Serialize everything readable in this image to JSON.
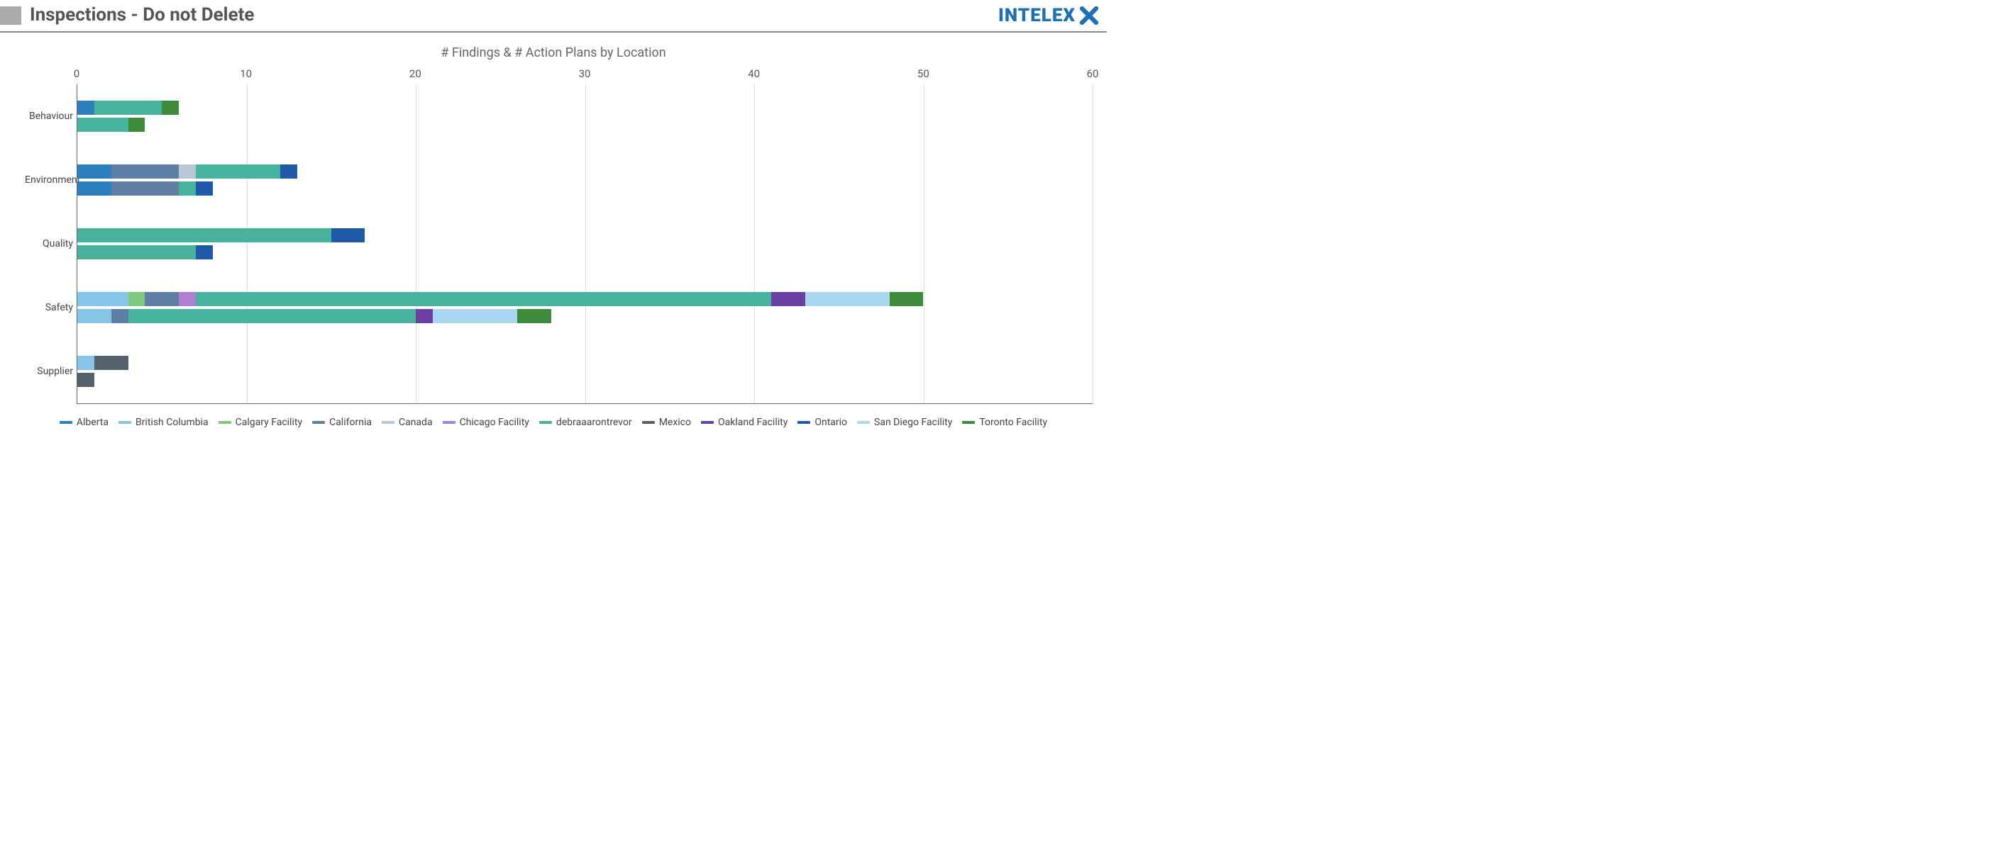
{
  "header": {
    "title": "Inspections - Do not Delete",
    "brand": "INTELEX"
  },
  "chart_data": {
    "type": "bar",
    "orientation": "horizontal-stacked-grouped",
    "title": "# Findings & # Action Plans by Location",
    "xlim": [
      0,
      60
    ],
    "xticks": [
      0,
      10,
      20,
      30,
      40,
      50,
      60
    ],
    "categories": [
      "Behaviour",
      "Environment",
      "Quality",
      "Safety",
      "Supplier"
    ],
    "subgroups": [
      "Findings",
      "Action Plans"
    ],
    "series": [
      {
        "name": "Alberta",
        "color": "#2e7fbd"
      },
      {
        "name": "British Columbia",
        "color": "#86c5e8"
      },
      {
        "name": "Calgary Facility",
        "color": "#7fc97f"
      },
      {
        "name": "California",
        "color": "#5e7fa3"
      },
      {
        "name": "Canada",
        "color": "#b7c5d4"
      },
      {
        "name": "Chicago Facility",
        "color": "#b07fcf"
      },
      {
        "name": "debraaarontrevor",
        "color": "#47b39c"
      },
      {
        "name": "Mexico",
        "color": "#54606a"
      },
      {
        "name": "Oakland Facility",
        "color": "#6a3fa0"
      },
      {
        "name": "Ontario",
        "color": "#1e5aa8"
      },
      {
        "name": "San Diego Facility",
        "color": "#a9d6f0"
      },
      {
        "name": "Toronto Facility",
        "color": "#3c8c3c"
      }
    ],
    "data": {
      "Behaviour": {
        "Findings": {
          "Alberta": 1,
          "debraaarontrevor": 4,
          "Toronto Facility": 1
        },
        "Action Plans": {
          "debraaarontrevor": 3,
          "Toronto Facility": 1
        }
      },
      "Environment": {
        "Findings": {
          "Alberta": 2,
          "California": 4,
          "Canada": 1,
          "debraaarontrevor": 5,
          "Ontario": 1
        },
        "Action Plans": {
          "Alberta": 2,
          "California": 4,
          "debraaarontrevor": 1,
          "Ontario": 1
        }
      },
      "Quality": {
        "Findings": {
          "debraaarontrevor": 15,
          "Ontario": 2
        },
        "Action Plans": {
          "debraaarontrevor": 7,
          "Ontario": 1
        }
      },
      "Safety": {
        "Findings": {
          "British Columbia": 3,
          "Calgary Facility": 1,
          "California": 2,
          "Chicago Facility": 1,
          "debraaarontrevor": 34,
          "Oakland Facility": 2,
          "San Diego Facility": 5,
          "Toronto Facility": 2
        },
        "Action Plans": {
          "British Columbia": 2,
          "California": 1,
          "debraaarontrevor": 17,
          "Oakland Facility": 1,
          "San Diego Facility": 5,
          "Toronto Facility": 2
        }
      },
      "Supplier": {
        "Findings": {
          "British Columbia": 1,
          "Mexico": 2
        },
        "Action Plans": {
          "Mexico": 1
        }
      }
    }
  }
}
